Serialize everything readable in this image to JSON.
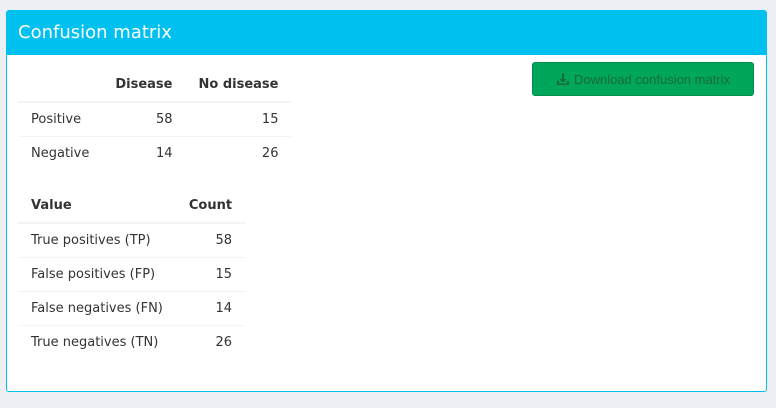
{
  "panel": {
    "title": "Confusion matrix",
    "download_label": "Download confusion matrix"
  },
  "confusion_matrix": {
    "headers": [
      "",
      "Disease",
      "No disease"
    ],
    "rows": [
      {
        "label": "Positive",
        "disease": "58",
        "no_disease": "15"
      },
      {
        "label": "Negative",
        "disease": "14",
        "no_disease": "26"
      }
    ]
  },
  "counts": {
    "headers": [
      "Value",
      "Count"
    ],
    "rows": [
      {
        "label": "True positives (TP)",
        "count": "58"
      },
      {
        "label": "False positives (FP)",
        "count": "15"
      },
      {
        "label": "False negatives (FN)",
        "count": "14"
      },
      {
        "label": "True negatives (TN)",
        "count": "26"
      }
    ]
  },
  "colors": {
    "header_bg": "#00c0ef",
    "button_bg": "#00a65a",
    "button_text": "#1a6b34",
    "page_bg": "#ecf0f5"
  },
  "icons": {
    "download": "download-icon"
  }
}
